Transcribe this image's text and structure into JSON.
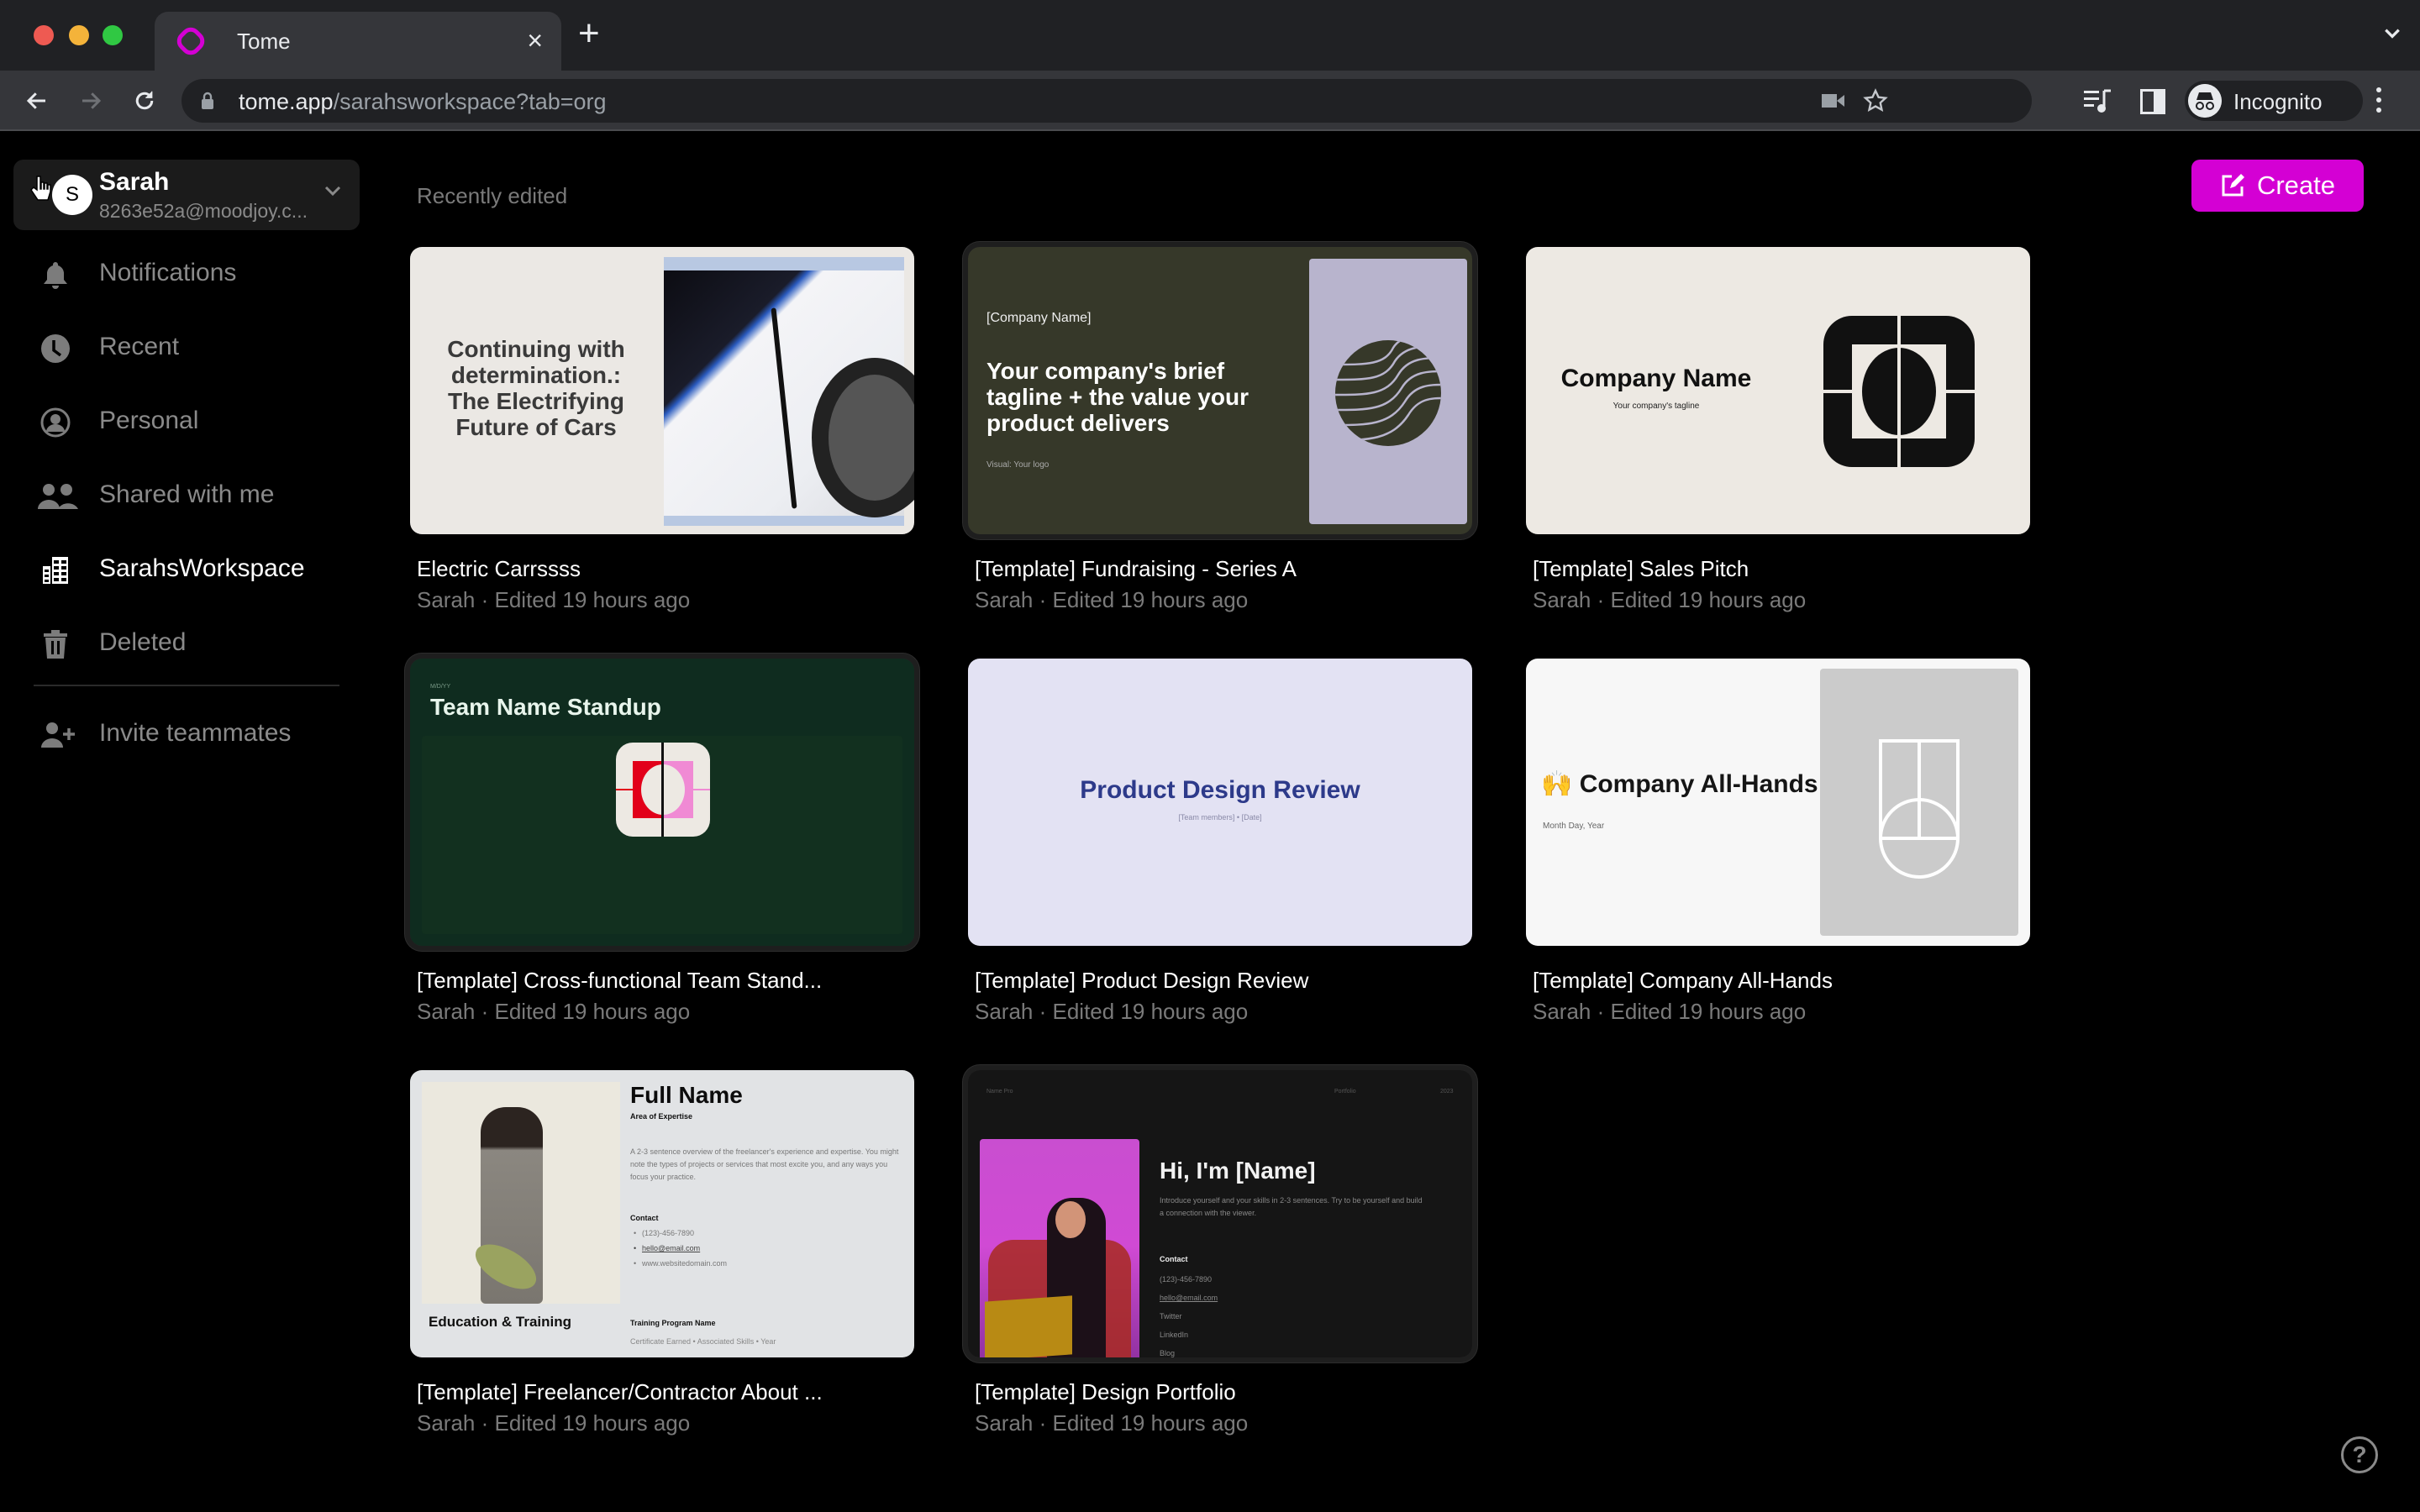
{
  "browser": {
    "tab_title": "Tome",
    "close_tab": "×",
    "new_tab": "+",
    "url_host": "tome.app",
    "url_path": "/sarahsworkspace?tab=org",
    "profile_label": "Incognito",
    "icons": [
      "back-icon",
      "forward-icon",
      "reload-icon",
      "lock-icon",
      "camera-off-icon",
      "bookmark-star-icon",
      "media-control-icon",
      "side-panel-icon",
      "incognito-icon",
      "more-menu-icon",
      "tab-search-chevron-icon"
    ]
  },
  "sidebar": {
    "account": {
      "initial": "S",
      "name": "Sarah",
      "email": "8263e52a@moodjoy.c..."
    },
    "items": [
      {
        "label": "Notifications",
        "icon": "bell-icon",
        "active": false
      },
      {
        "label": "Recent",
        "icon": "clock-icon",
        "active": false
      },
      {
        "label": "Personal",
        "icon": "person-circle-icon",
        "active": false
      },
      {
        "label": "Shared with me",
        "icon": "people-icon",
        "active": false
      },
      {
        "label": "SarahsWorkspace",
        "icon": "building-icon",
        "active": true
      },
      {
        "label": "Deleted",
        "icon": "trash-icon",
        "active": false
      }
    ],
    "invite_label": "Invite teammates"
  },
  "main": {
    "section_title": "Recently edited",
    "create_label": "Create",
    "accent_color": "#d400d4",
    "cards": [
      {
        "title": "Electric Carrssss",
        "meta": "Sarah · Edited 19 hours ago",
        "thumb": {
          "heading": "Continuing with determination.: The Electrifying Future of Cars"
        }
      },
      {
        "title": "[Template] Fundraising - Series A",
        "meta": "Sarah · Edited 19 hours ago",
        "thumb": {
          "company": "[Company Name]",
          "tagline": "Your company's brief tagline + the value your product delivers",
          "visual": "Visual: Your logo"
        }
      },
      {
        "title": "[Template] Sales Pitch",
        "meta": "Sarah · Edited 19 hours ago",
        "thumb": {
          "company": "Company Name",
          "tagline": "Your company's tagline"
        }
      },
      {
        "title": "[Template] Cross-functional Team Stand...",
        "meta": "Sarah · Edited 19 hours ago",
        "thumb": {
          "date": "M/D/YY",
          "heading": "Team Name Standup"
        }
      },
      {
        "title": "[Template] Product Design Review",
        "meta": "Sarah · Edited 19 hours ago",
        "thumb": {
          "heading": "Product Design Review",
          "sub": "[Team members] • [Date]"
        }
      },
      {
        "title": "[Template] Company All-Hands",
        "meta": "Sarah · Edited 19 hours ago",
        "thumb": {
          "heading": "🙌 Company All-Hands",
          "sub": "Month Day, Year"
        }
      },
      {
        "title": "[Template] Freelancer/Contractor About ...",
        "meta": "Sarah · Edited 19 hours ago",
        "thumb": {
          "name": "Full Name",
          "expertise": "Area of Expertise",
          "overview": "A 2-3 sentence overview of the freelancer's experience and expertise. You might note the types of projects or services that most excite you, and any ways you focus your practice.",
          "contact_label": "Contact",
          "phone": "(123)-456-7890",
          "email": "hello@email.com",
          "website": "www.websitedomain.com",
          "education": "Education & Training",
          "program": "Training Program Name",
          "program_sub": "Certificate Earned • Associated Skills • Year"
        }
      },
      {
        "title": "[Template] Design Portfolio",
        "meta": "Sarah · Edited 19 hours ago",
        "thumb": {
          "top_left": "Name Pro",
          "top_mid": "Portfolio",
          "top_right": "2023",
          "heading": "Hi, I'm [Name]",
          "intro": "Introduce yourself and your skills in 2-3 sentences. Try to be yourself and build a connection with the viewer.",
          "contact_label": "Contact",
          "phone": "(123)-456-7890",
          "email": "hello@email.com",
          "links": [
            "Twitter",
            "LinkedIn",
            "Blog"
          ]
        }
      }
    ],
    "help_label": "?"
  }
}
